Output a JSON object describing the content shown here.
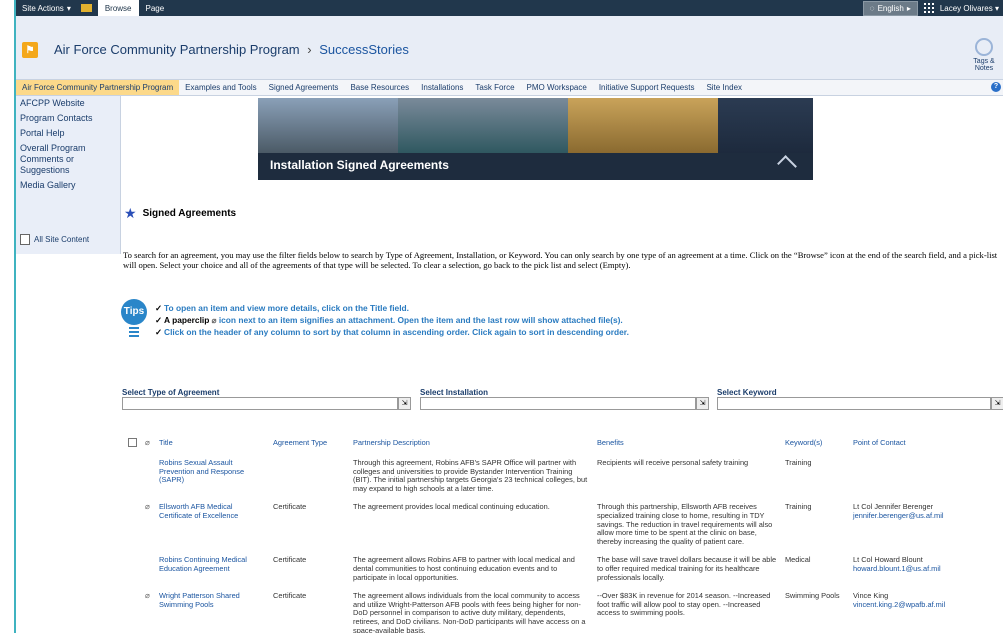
{
  "ribbon": {
    "site_actions": "Site Actions",
    "tabs": [
      "Browse",
      "Page"
    ],
    "language": "English",
    "user": "Lacey Olivares"
  },
  "header": {
    "site_title": "Air Force Community Partnership Program",
    "separator": "›",
    "current_page": "SuccessStories",
    "tags_label": "Tags & Notes"
  },
  "topnav": {
    "items": [
      "Air Force Community Partnership Program",
      "Examples and Tools",
      "Signed Agreements",
      "Base Resources",
      "Installations",
      "Task Force",
      "PMO Workspace",
      "Initiative Support Requests",
      "Site Index"
    ],
    "help": "?"
  },
  "leftnav": {
    "items": [
      "AFCPP Website",
      "Program Contacts",
      "Portal Help",
      "Overall Program Comments or Suggestions",
      "Media Gallery"
    ],
    "all_site_content": "All Site Content"
  },
  "banner": {
    "title": "Installation Signed Agreements"
  },
  "page": {
    "heading": "Signed Agreements",
    "intro": "To search for an agreement, you may use the filter fields below to search by Type of Agreement, Installation, or Keyword. You can only search by one type of an agreement at a time. Click on the “Browse” icon at the end of the search field, and a pick-list will open. Select your choice and all of the agreements of that type will be selected. To clear a selection, go back to the pick list and select (Empty)."
  },
  "tips": {
    "icon_label": "Tips",
    "line1": "To open an item and view more details, click on the Title field.",
    "line2_a": "A ",
    "line2_b": "paperclip",
    "line2_c": " icon next to an item signifies an attachment.  Open the item and the last row will show attached file(s).",
    "line3": "Click on the header of any column to sort by that column in ascending order. Click again to sort in descending order."
  },
  "filters": {
    "type_label": "Select Type of Agreement",
    "installation_label": "Select Installation",
    "keyword_label": "Select Keyword"
  },
  "table": {
    "headers": [
      "Title",
      "Agreement Type",
      "Partnership Description",
      "Benefits",
      "Keyword(s)",
      "Point of Contact"
    ],
    "rows": [
      {
        "title": "Robins Sexual Assault Prevention and Response (SAPR)",
        "type": "",
        "description": "Through this agreement, Robins AFB's SAPR Office will partner with colleges and universities to provide Bystander Intervention Training (BIT). The initial partnership targets Georgia's 23 technical colleges, but may expand to high schools at a later time.",
        "benefits": "Recipients will receive personal safety training",
        "keywords": "Training",
        "contact_name": "",
        "contact_email": ""
      },
      {
        "title": "Ellsworth AFB Medical Certificate of Excellence",
        "type": "Certificate",
        "description": "The agreement provides local medical continuing education.",
        "benefits": "Through this partnership, Ellsworth AFB receives specialized training close to home, resulting in TDY savings. The reduction in travel requirements will also allow more time to be spent at the clinic on base, thereby increasing the quality of patient care.",
        "keywords": "Training",
        "contact_name": "Lt Col Jennifer Berenger",
        "contact_email": "jennifer.berenger@us.af.mil"
      },
      {
        "title": "Robins Continuing Medical Education Agreement",
        "type": "Certificate",
        "description": "The agreement allows Robins AFB to partner with local medical and dental communities to host continuing education events and to participate in local opportunities.",
        "benefits": "The base will save travel dollars because it will be able to offer required medical training for its healthcare professionals locally.",
        "keywords": "Medical",
        "contact_name": "Lt Col Howard Blount",
        "contact_email": "howard.blount.1@us.af.mil"
      },
      {
        "title": "Wright Patterson Shared Swimming Pools",
        "type": "Certificate",
        "description": "The agreement allows individuals from the local community to access and utilize Wright-Patterson AFB pools with fees being higher for non-DoD personnel in comparison to active duty military, dependents, retirees, and DoD civilians. Non-DoD participants will have access on a space-available basis.",
        "benefits": "--Over $83K in revenue for 2014 season. --Increased foot traffic will allow pool to stay open. --Increased access to swimming pools.",
        "keywords": "Swimming Pools",
        "contact_name": "Vince King",
        "contact_email": "vincent.king.2@wpafb.af.mil"
      }
    ]
  }
}
